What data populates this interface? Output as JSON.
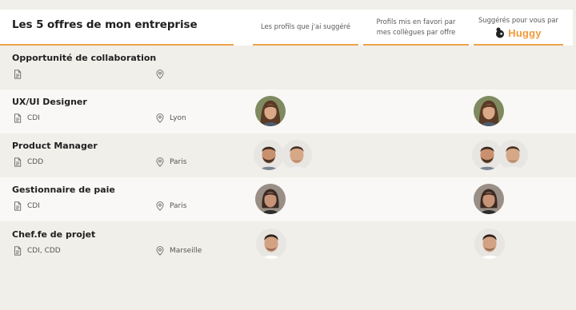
{
  "header": {
    "title": "Les 5 offres de mon entreprise",
    "col_suggested_by_me": "Les profils que j'ai suggéré",
    "col_colleague_favs_line1": "Profils mis en favori par",
    "col_colleague_favs_line2": "mes collègues par offre",
    "col_huggy_label": "Suggérés pour vous par",
    "col_huggy_brand": "Huggy",
    "accent_color": "#f0a04b"
  },
  "jobs": [
    {
      "title": "Opportunité de collaboration",
      "contract": "",
      "location": "",
      "my_profiles": [],
      "huggy_profiles": []
    },
    {
      "title": "UX/UI Designer",
      "contract": "CDI",
      "location": "Lyon",
      "my_profiles": [
        "woman-brown-hair"
      ],
      "huggy_profiles": [
        "woman-brown-hair"
      ]
    },
    {
      "title": "Product Manager",
      "contract": "CDD",
      "location": "Paris",
      "my_profiles": [
        "man-beard",
        "man-short-hair"
      ],
      "huggy_profiles": [
        "man-beard",
        "man-short-hair"
      ]
    },
    {
      "title": "Gestionnaire de paie",
      "contract": "CDI",
      "location": "Paris",
      "my_profiles": [
        "woman-dark-hair"
      ],
      "huggy_profiles": [
        "woman-dark-hair"
      ]
    },
    {
      "title": "Chef.fe de projet",
      "contract": "CDI, CDD",
      "location": "Marseille",
      "my_profiles": [
        "man-dark-hair"
      ],
      "huggy_profiles": [
        "man-dark-hair"
      ]
    }
  ],
  "icons": {
    "contract": "document-icon",
    "location": "map-pin-icon",
    "brand": "huggy-logo-icon"
  }
}
